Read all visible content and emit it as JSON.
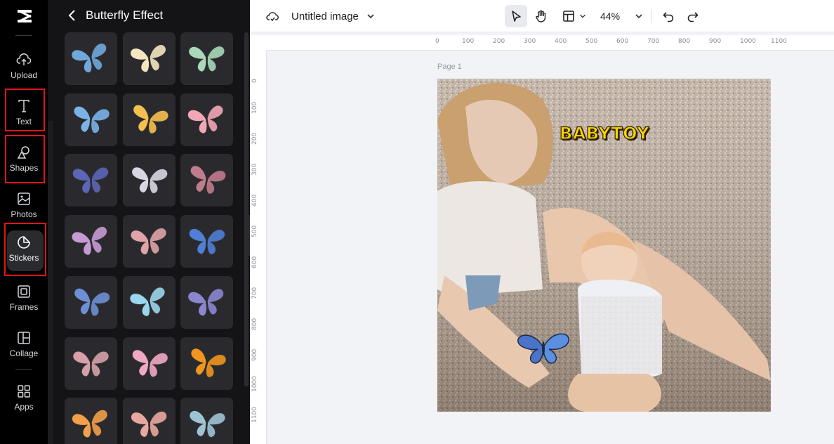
{
  "rail": {
    "items": [
      {
        "label": "Upload",
        "icon": "upload-cloud-icon"
      },
      {
        "label": "Text",
        "icon": "text-icon"
      },
      {
        "label": "Shapes",
        "icon": "shapes-icon"
      },
      {
        "label": "Photos",
        "icon": "photos-icon"
      },
      {
        "label": "Stickers",
        "icon": "stickers-icon",
        "active": true
      },
      {
        "label": "Frames",
        "icon": "frames-icon"
      },
      {
        "label": "Collage",
        "icon": "collage-icon"
      },
      {
        "label": "Apps",
        "icon": "apps-icon"
      }
    ]
  },
  "panel": {
    "title": "Butterfly Effect",
    "sticker_colors": [
      "#6fa9dc",
      "#f4e6c0",
      "#a8d8b9",
      "#7ab3e8",
      "#f6c04f",
      "#f2a7b6",
      "#5b66b8",
      "#d9d6e4",
      "#c07c8c",
      "#c79ad6",
      "#e0a3a8",
      "#4f7fd6",
      "#6d8fd6",
      "#9ad6ee",
      "#8a86d0",
      "#d6a0a8",
      "#f0a9c2",
      "#f0961e",
      "#f2a04a",
      "#e8a8a0",
      "#9ec4d4"
    ]
  },
  "toolbar": {
    "title": "Untitled image",
    "zoom": "44%"
  },
  "rulers": {
    "horizontal": [
      "0",
      "100",
      "200",
      "300",
      "400",
      "500",
      "600",
      "700",
      "800",
      "900",
      "1000",
      "1100"
    ],
    "vertical": [
      "0",
      "100",
      "200",
      "300",
      "400",
      "500",
      "600",
      "700",
      "800",
      "900",
      "1000",
      "1100"
    ]
  },
  "canvas": {
    "page_label": "Page 1",
    "text_element": "BABYTOY"
  }
}
